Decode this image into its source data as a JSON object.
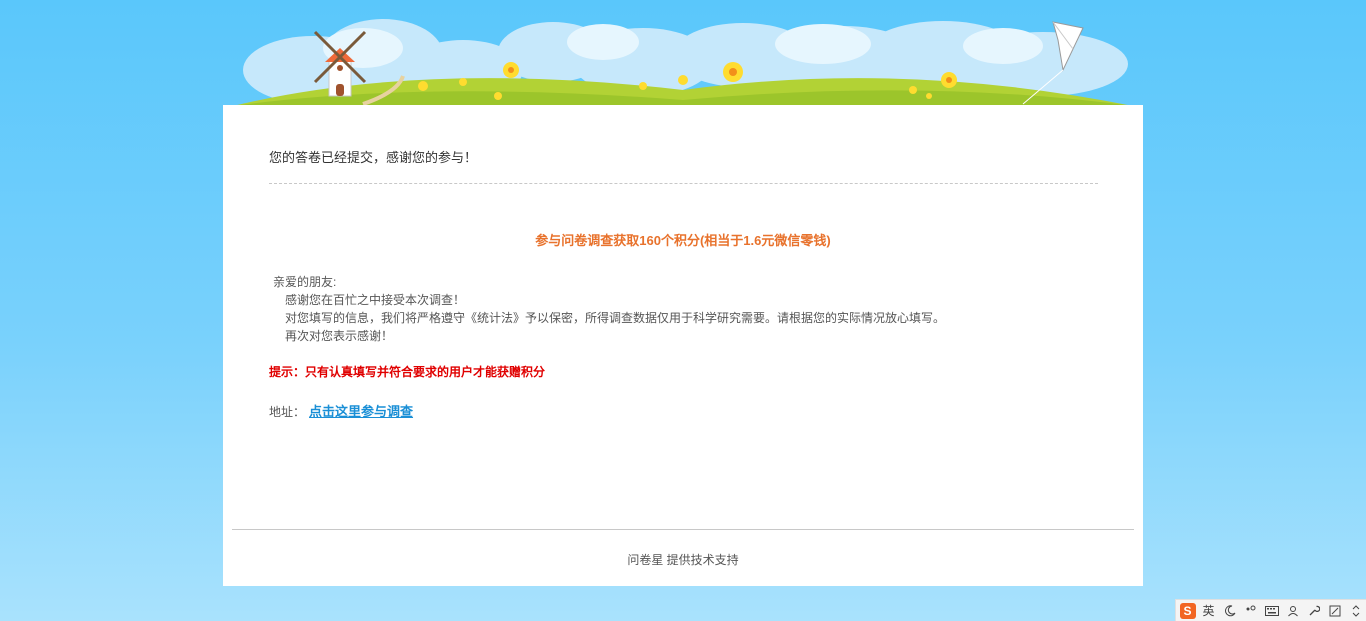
{
  "page": {
    "submitted_message": "您的答卷已经提交，感谢您的参与！",
    "reward_title": "参与问卷调查获取160个积分(相当于1.6元微信零钱)",
    "intro_lines": [
      "亲爱的朋友:",
      "感谢您在百忙之中接受本次调查！",
      "对您填写的信息，我们将严格遵守《统计法》予以保密，所得调查数据仅用于科学研究需要。请根据您的实际情况放心填写。",
      "再次对您表示感谢！"
    ],
    "tip": "提示：只有认真填写并符合要求的用户才能获赠积分",
    "address_label": "地址：",
    "address_link": "点击这里参与调查",
    "footer_credit": "问卷星 提供技术支持"
  },
  "ime_toolbar": {
    "logo": "S",
    "mode_label": "英",
    "icons": [
      "moon-icon",
      "punctuation-icon",
      "keyboard-icon",
      "user-icon",
      "wrench-icon",
      "skin-icon",
      "more-icon"
    ]
  },
  "colors": {
    "background": "#5ac7fb",
    "card": "#ffffff",
    "accent_orange": "#e8722c",
    "tip_red": "#e00000",
    "link_blue": "#1a8fd6"
  }
}
